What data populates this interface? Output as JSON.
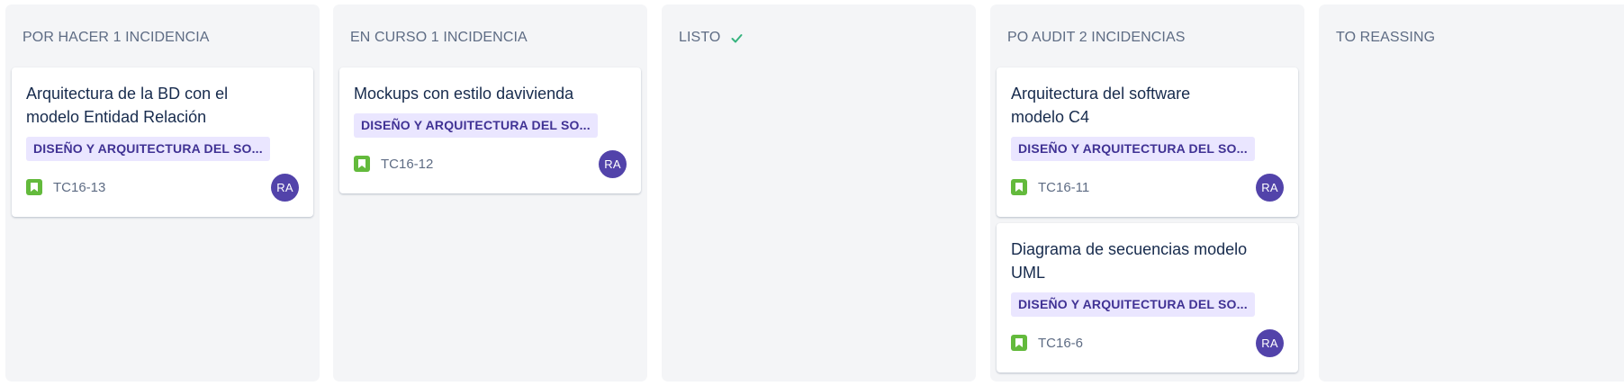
{
  "columns": [
    {
      "title": "POR HACER 1 INCIDENCIA",
      "cards": [
        {
          "title": "Arquitectura de la BD con el modelo Entidad Relación",
          "epic": "DISEÑO Y ARQUITECTURA DEL SO...",
          "key": "TC16-13",
          "assignee_initials": "RA"
        }
      ]
    },
    {
      "title": "EN CURSO 1 INCIDENCIA",
      "cards": [
        {
          "title": "Mockups con estilo davivienda",
          "epic": "DISEÑO Y ARQUITECTURA DEL SO...",
          "key": "TC16-12",
          "assignee_initials": "RA"
        }
      ]
    },
    {
      "title": "LISTO",
      "done_icon": "check-icon",
      "cards": []
    },
    {
      "title": "PO AUDIT 2 INCIDENCIAS",
      "cards": [
        {
          "title": "Arquitectura del software modelo C4",
          "epic": "DISEÑO Y ARQUITECTURA DEL SO...",
          "key": "TC16-11",
          "assignee_initials": "RA"
        },
        {
          "title": "Diagrama de secuencias modelo UML",
          "epic": "DISEÑO Y ARQUITECTURA DEL SO...",
          "key": "TC16-6",
          "assignee_initials": "RA"
        }
      ]
    },
    {
      "title": "TO REASSING",
      "cards": []
    }
  ],
  "colors": {
    "column_bg": "#f4f5f7",
    "epic_bg": "#eae6ff",
    "epic_text": "#403294",
    "story_icon": "#63ba3c",
    "avatar_bg": "#5243aa",
    "done_check": "#36b37e"
  }
}
